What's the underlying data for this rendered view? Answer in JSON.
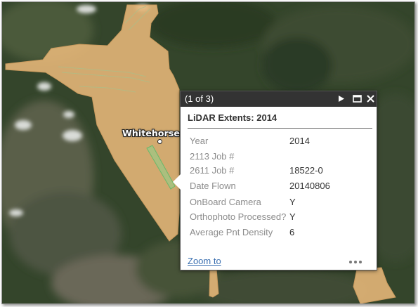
{
  "map": {
    "city_label": "Whitehorse"
  },
  "popup": {
    "counter": "(1 of 3)",
    "title": "LiDAR Extents: 2014",
    "attributes": [
      {
        "label": "Year",
        "value": "2014"
      },
      {
        "label": "2113 Job #",
        "value": ""
      },
      {
        "label": "2611 Job #",
        "value": "18522-0"
      },
      {
        "label": "Date Flown",
        "value": "20140806"
      },
      {
        "label": "OnBoard Camera",
        "value": "Y"
      },
      {
        "label": "Orthophoto Processed?",
        "value": "Y"
      },
      {
        "label": "Average Pnt Density",
        "value": "6"
      }
    ],
    "zoom_label": "Zoom to",
    "icons": {
      "next": "next-feature-icon",
      "maximize": "maximize-icon",
      "close": "close-icon",
      "more": "more-options-icon"
    }
  },
  "colors": {
    "lidar_fill": "#e8b87a",
    "popup_header": "#333333",
    "link": "#3a6fb0",
    "label_gray": "#8c8c8c"
  }
}
